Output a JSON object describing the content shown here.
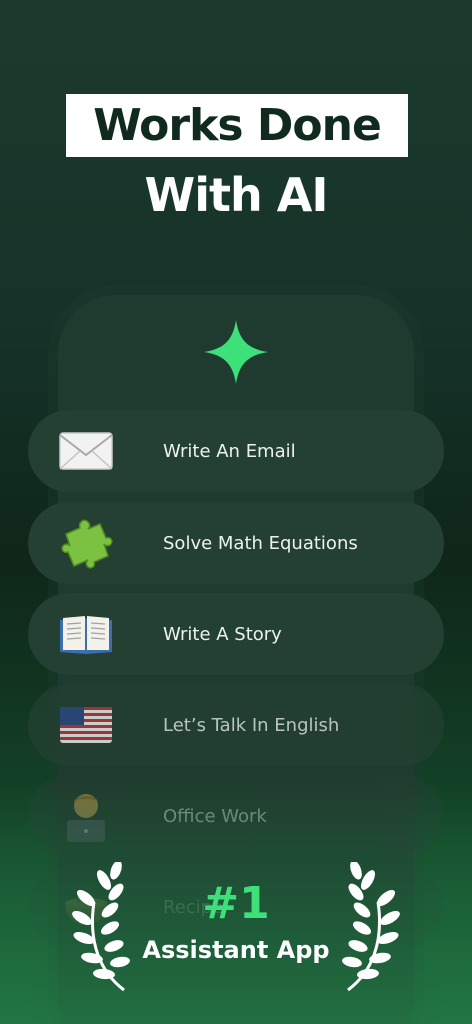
{
  "headline": {
    "line1": "Works Done",
    "line2": "With AI"
  },
  "features": [
    {
      "label": "Write An Email",
      "icon": "envelope-icon"
    },
    {
      "label": "Solve Math Equations",
      "icon": "puzzle-icon"
    },
    {
      "label": "Write A Story",
      "icon": "open-book-icon"
    },
    {
      "label": "Let’s Talk In English",
      "icon": "us-flag-icon"
    },
    {
      "label": "Office Work",
      "icon": "technologist-icon"
    },
    {
      "label": "Recipe",
      "icon": "bowl-icon"
    }
  ],
  "badge": {
    "rank": "#1",
    "text": "Assistant App"
  },
  "colors": {
    "accent": "#3ee07a",
    "background": "#16332a",
    "card": "#234032"
  }
}
